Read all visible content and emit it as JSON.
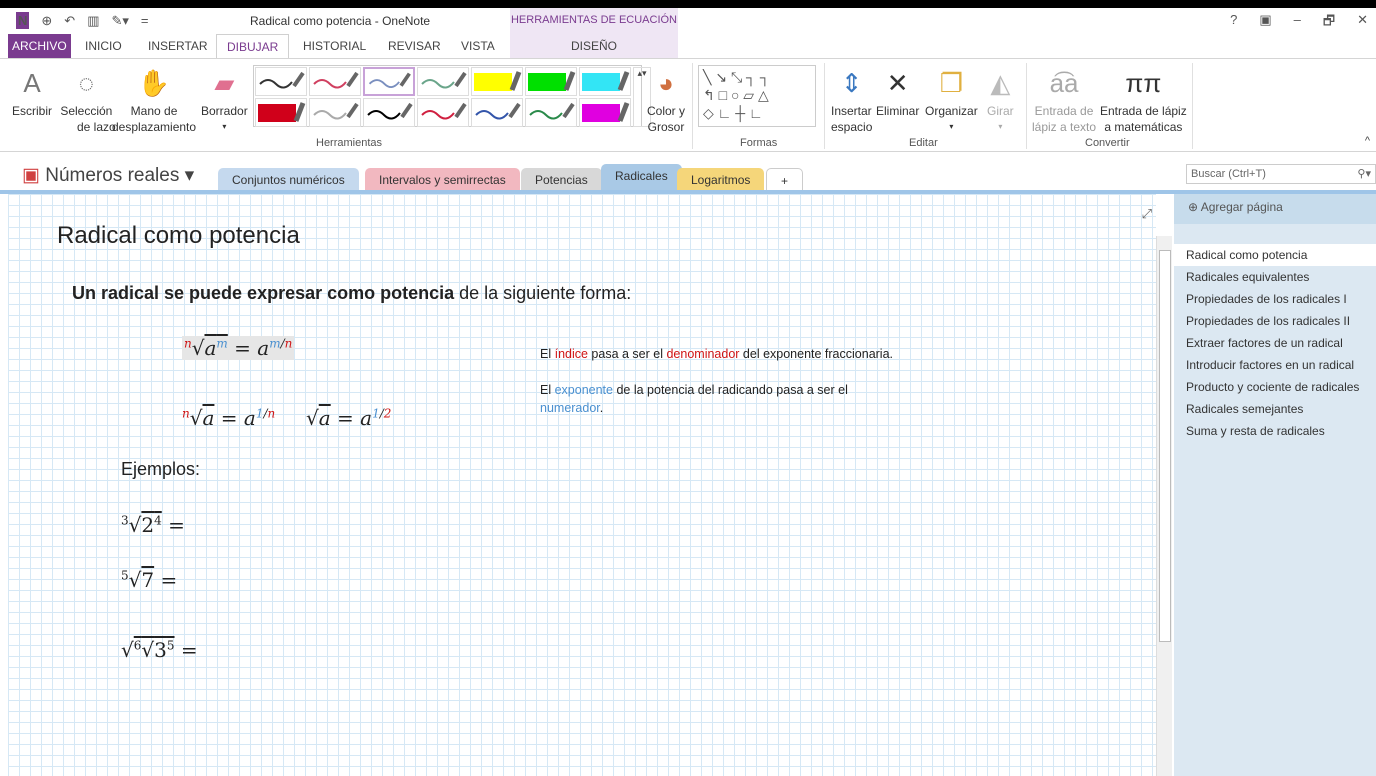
{
  "window": {
    "title": "Radical como potencia - OneNote",
    "context_tab": "HERRAMIENTAS DE ECUACIÓN",
    "controls": [
      "?",
      "▣",
      "–",
      "🗗",
      "✕"
    ]
  },
  "tabs": [
    "ARCHIVO",
    "INICIO",
    "INSERTAR",
    "DIBUJAR",
    "HISTORIAL",
    "REVISAR",
    "VISTA",
    "DISEÑO"
  ],
  "ribbon": {
    "tools": [
      {
        "l1": "Escribir",
        "l2": ""
      },
      {
        "l1": "Selección",
        "l2": "de lazo"
      },
      {
        "l1": "Mano de",
        "l2": "desplazamiento"
      },
      {
        "l1": "Borrador",
        "l2": "▾"
      }
    ],
    "color": {
      "l1": "Color y",
      "l2": "Grosor"
    },
    "edit": [
      {
        "l1": "Insertar",
        "l2": "espacio"
      },
      {
        "l1": "Eliminar",
        "l2": ""
      },
      {
        "l1": "Organizar",
        "l2": "▾"
      },
      {
        "l1": "Girar",
        "l2": "▾"
      }
    ],
    "convert": [
      {
        "l1": "Entrada de",
        "l2": "lápiz a texto"
      },
      {
        "l1": "Entrada de lápiz",
        "l2": "a matemáticas"
      }
    ],
    "groups": {
      "herramientas": "Herramientas",
      "formas": "Formas",
      "editar": "Editar",
      "convertir": "Convertir"
    },
    "pens": [
      "#333",
      "#d04060",
      "#7a8fbf",
      "#6aa58a",
      "#ffff00",
      "#00e000",
      "#33e5f5",
      "#d0001a",
      "#aaa",
      "#000",
      "#d02040",
      "#3355aa",
      "#2a8a4a",
      "#e000e0"
    ]
  },
  "notebook": {
    "name": "Números reales ▾"
  },
  "sections": [
    {
      "label": "Conjuntos numéricos",
      "color": "#c5d9ee"
    },
    {
      "label": "Intervalos y semirrectas",
      "color": "#f2b8c0"
    },
    {
      "label": "Potencias",
      "color": "#d8d8d8"
    },
    {
      "label": "Radicales",
      "color": "#a9c9e6"
    },
    {
      "label": "Logaritmos",
      "color": "#f5d67a"
    },
    {
      "label": "+",
      "color": "#fff"
    }
  ],
  "search": {
    "placeholder": "Buscar (Ctrl+T)"
  },
  "sidebar": {
    "add_page": "Agregar página",
    "pages": [
      "Radical como potencia",
      "Radicales equivalentes",
      "Propiedades de los radicales I",
      "Propiedades de los radicales II",
      "Extraer factores de un radical",
      "Introducir factores en un radical",
      "Producto y cociente de radicales",
      "Radicales semejantes",
      "Suma y resta de radicales"
    ]
  },
  "page": {
    "title": "Radical como potencia",
    "intro_bold": "Un radical se puede expresar como potencia",
    "intro_rest": " de la siguiente forma:",
    "note1": {
      "a": "El ",
      "b": "índice",
      "c": " pasa a ser el ",
      "d": "denominador",
      "e": " del exponente fraccionaria."
    },
    "note2": {
      "a": "El ",
      "b": "exponente",
      "c": " de la potencia del radicando pasa a ser el ",
      "d": "numerador",
      "e": "."
    },
    "examples": "Ejemplos:"
  }
}
